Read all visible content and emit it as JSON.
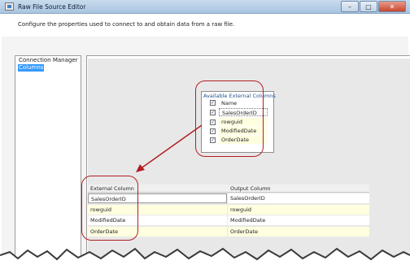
{
  "window": {
    "title": "Raw File Source Editor",
    "minimize_glyph": "–",
    "maximize_glyph": "□",
    "close_glyph": "✕"
  },
  "description": "Configure the properties used to connect to and obtain data from a raw file.",
  "nav": {
    "items": [
      "Connection Manager",
      "Columns"
    ],
    "selected": "Columns"
  },
  "available_columns": {
    "title": "Available External Columns",
    "header": "Name",
    "items": [
      "SalesOrderID",
      "rowguid",
      "ModifiedDate",
      "OrderDate"
    ],
    "check_glyph": "✓"
  },
  "mapping_grid": {
    "columns": [
      "External Column",
      "Output Column"
    ],
    "rows": [
      [
        "SalesOrderID",
        "SalesOrderID"
      ],
      [
        "rowguid",
        "rowguid"
      ],
      [
        "ModifiedDate",
        "ModifiedDate"
      ],
      [
        "OrderDate",
        "OrderDate"
      ]
    ]
  },
  "colors": {
    "callout": "#b21f24",
    "selection": "#3399ff",
    "row_highlight": "#ffffe0"
  }
}
